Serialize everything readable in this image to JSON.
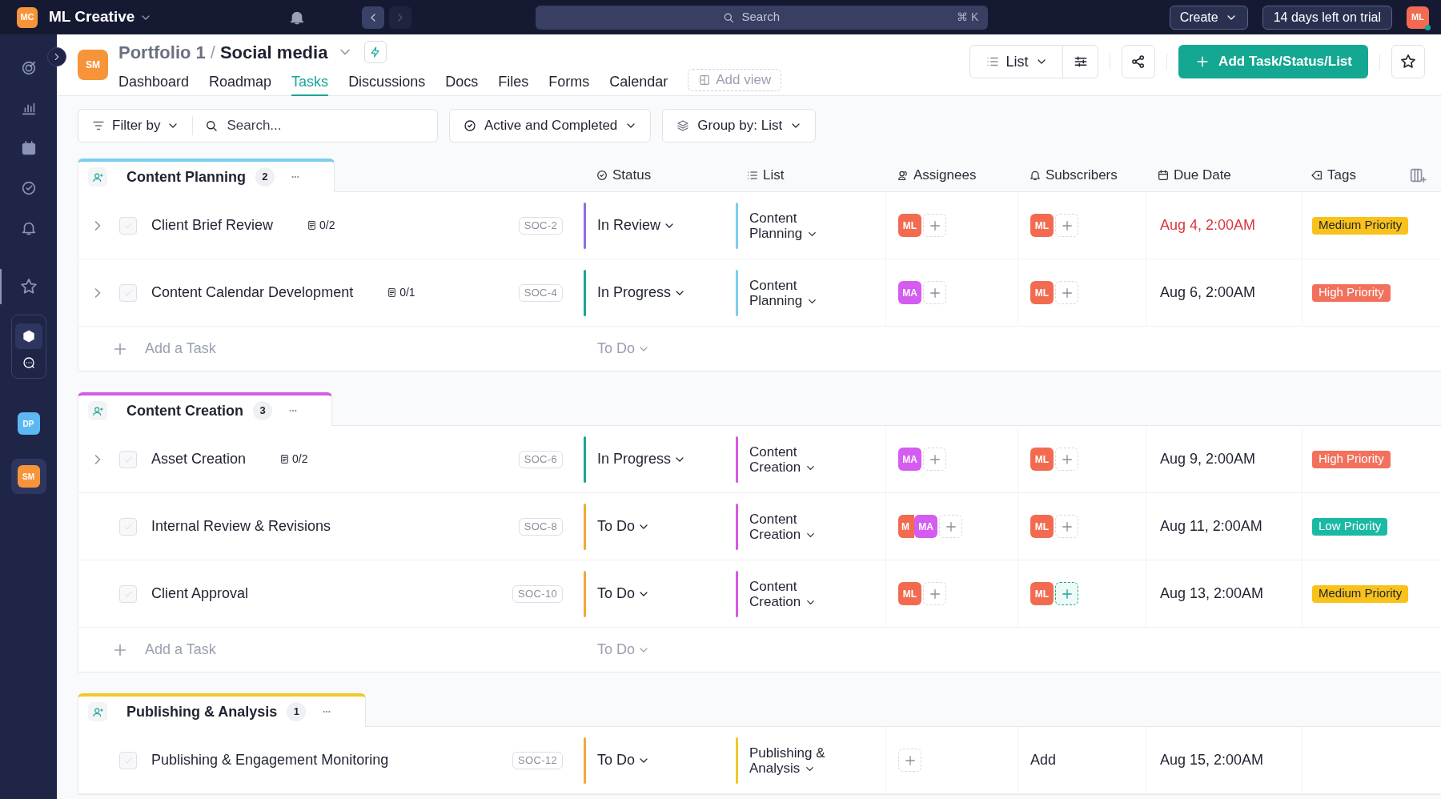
{
  "top_bar": {
    "workspace_initials": "MC",
    "workspace_name": "ML Creative",
    "search_placeholder": "Search",
    "search_shortcut": "⌘ K",
    "create": "Create",
    "trial": "14 days left on trial",
    "user_initials": "ML"
  },
  "sidebar": {
    "spaces": [
      {
        "initials": "DP",
        "color": "#5db7f2",
        "selected": false
      },
      {
        "initials": "SM",
        "color": "#f7943a",
        "selected": true
      }
    ]
  },
  "header": {
    "space_initials": "SM",
    "parent": "Portfolio 1",
    "separator": "/",
    "title": "Social media",
    "tabs": [
      {
        "label": "Dashboard",
        "selected": false
      },
      {
        "label": "Roadmap",
        "selected": false
      },
      {
        "label": "Tasks",
        "selected": true
      },
      {
        "label": "Discussions",
        "selected": false
      },
      {
        "label": "Docs",
        "selected": false
      },
      {
        "label": "Files",
        "selected": false
      },
      {
        "label": "Forms",
        "selected": false
      },
      {
        "label": "Calendar",
        "selected": false
      }
    ],
    "add_view": "Add view",
    "view": "List",
    "add_button": "Add Task/Status/List"
  },
  "filters": {
    "filter": "Filter by",
    "search_placeholder": "Search...",
    "status_filter": "Active and Completed",
    "group_label": "Group by:",
    "group_value": "List"
  },
  "columns": [
    "Status",
    "List",
    "Assignees",
    "Subscribers",
    "Due Date",
    "Tags"
  ],
  "groups": [
    {
      "name": "Content Planning",
      "count": "2",
      "color": "#7dcdf0",
      "add_task": "Add a Task",
      "add_status": "To Do",
      "tasks": [
        {
          "expandable": true,
          "checked": false,
          "name": "Client Brief Review",
          "subtasks": "0/2",
          "id": "SOC-2",
          "status": {
            "label": "In Review",
            "color": "#8c6fe2"
          },
          "list": {
            "label": "Content Planning",
            "color": "#7dcdf0"
          },
          "assignees": [
            {
              "initials": "ML",
              "color": "#f26b50"
            }
          ],
          "subscribers": [
            {
              "initials": "ML",
              "color": "#f26b50"
            }
          ],
          "subscriber_add_focused": false,
          "due": "Aug 4, 2:00AM",
          "overdue": true,
          "tag": {
            "label": "Medium Priority",
            "color": "#f8c21b"
          }
        },
        {
          "expandable": true,
          "checked": false,
          "name": "Content Calendar Development",
          "subtasks": "0/1",
          "id": "SOC-4",
          "status": {
            "label": "In Progress",
            "color": "#1aa597"
          },
          "list": {
            "label": "Content Planning",
            "color": "#7dcdf0"
          },
          "assignees": [
            {
              "initials": "MA",
              "color": "#d45cf0"
            }
          ],
          "subscribers": [
            {
              "initials": "ML",
              "color": "#f26b50"
            }
          ],
          "subscriber_add_focused": false,
          "due": "Aug 6, 2:00AM",
          "overdue": false,
          "tag": {
            "label": "High Priority",
            "color": "#f2715d"
          }
        }
      ]
    },
    {
      "name": "Content Creation",
      "count": "3",
      "color": "#d85ae6",
      "add_task": "Add a Task",
      "add_status": "To Do",
      "tasks": [
        {
          "expandable": true,
          "checked": false,
          "name": "Asset Creation",
          "subtasks": "0/2",
          "id": "SOC-6",
          "status": {
            "label": "In Progress",
            "color": "#1aa597"
          },
          "list": {
            "label": "Content Creation",
            "color": "#d85ae6"
          },
          "assignees": [
            {
              "initials": "MA",
              "color": "#d45cf0"
            }
          ],
          "subscribers": [
            {
              "initials": "ML",
              "color": "#f26b50"
            }
          ],
          "subscriber_add_focused": false,
          "due": "Aug 9, 2:00AM",
          "overdue": false,
          "tag": {
            "label": "High Priority",
            "color": "#f2715d"
          }
        },
        {
          "expandable": false,
          "checked": false,
          "name": "Internal Review & Revisions",
          "id": "SOC-8",
          "status": {
            "label": "To Do",
            "color": "#f0a93a"
          },
          "list": {
            "label": "Content Creation",
            "color": "#d85ae6"
          },
          "assignees": [
            {
              "initials": "M",
              "color": "#f26b50"
            },
            {
              "initials": "MA",
              "color": "#d45cf0"
            }
          ],
          "subscribers": [
            {
              "initials": "ML",
              "color": "#f26b50"
            }
          ],
          "subscriber_add_focused": false,
          "due": "Aug 11, 2:00AM",
          "overdue": false,
          "tag": {
            "label": "Low Priority",
            "color": "#1ab9a4"
          }
        },
        {
          "expandable": false,
          "checked": false,
          "name": "Client Approval",
          "id": "SOC-10",
          "status": {
            "label": "To Do",
            "color": "#f0a93a"
          },
          "list": {
            "label": "Content Creation",
            "color": "#d85ae6"
          },
          "assignees": [
            {
              "initials": "ML",
              "color": "#f26b50"
            }
          ],
          "subscribers": [
            {
              "initials": "ML",
              "color": "#f26b50"
            }
          ],
          "subscriber_add_focused": true,
          "due": "Aug 13, 2:00AM",
          "overdue": false,
          "tag": {
            "label": "Medium Priority",
            "color": "#f8c21b"
          }
        }
      ]
    },
    {
      "name": "Publishing & Analysis",
      "count": "1",
      "color": "#f2c82a",
      "tasks": [
        {
          "expandable": false,
          "checked": false,
          "name": "Publishing & Engagement Monitoring",
          "id": "SOC-12",
          "status": {
            "label": "To Do",
            "color": "#f0a93a"
          },
          "list": {
            "label": "Publishing & Analysis",
            "color": "#f2c82a"
          },
          "subscribers_empty": "Add",
          "due": "Aug 15, 2:00AM",
          "overdue": false
        }
      ]
    }
  ]
}
